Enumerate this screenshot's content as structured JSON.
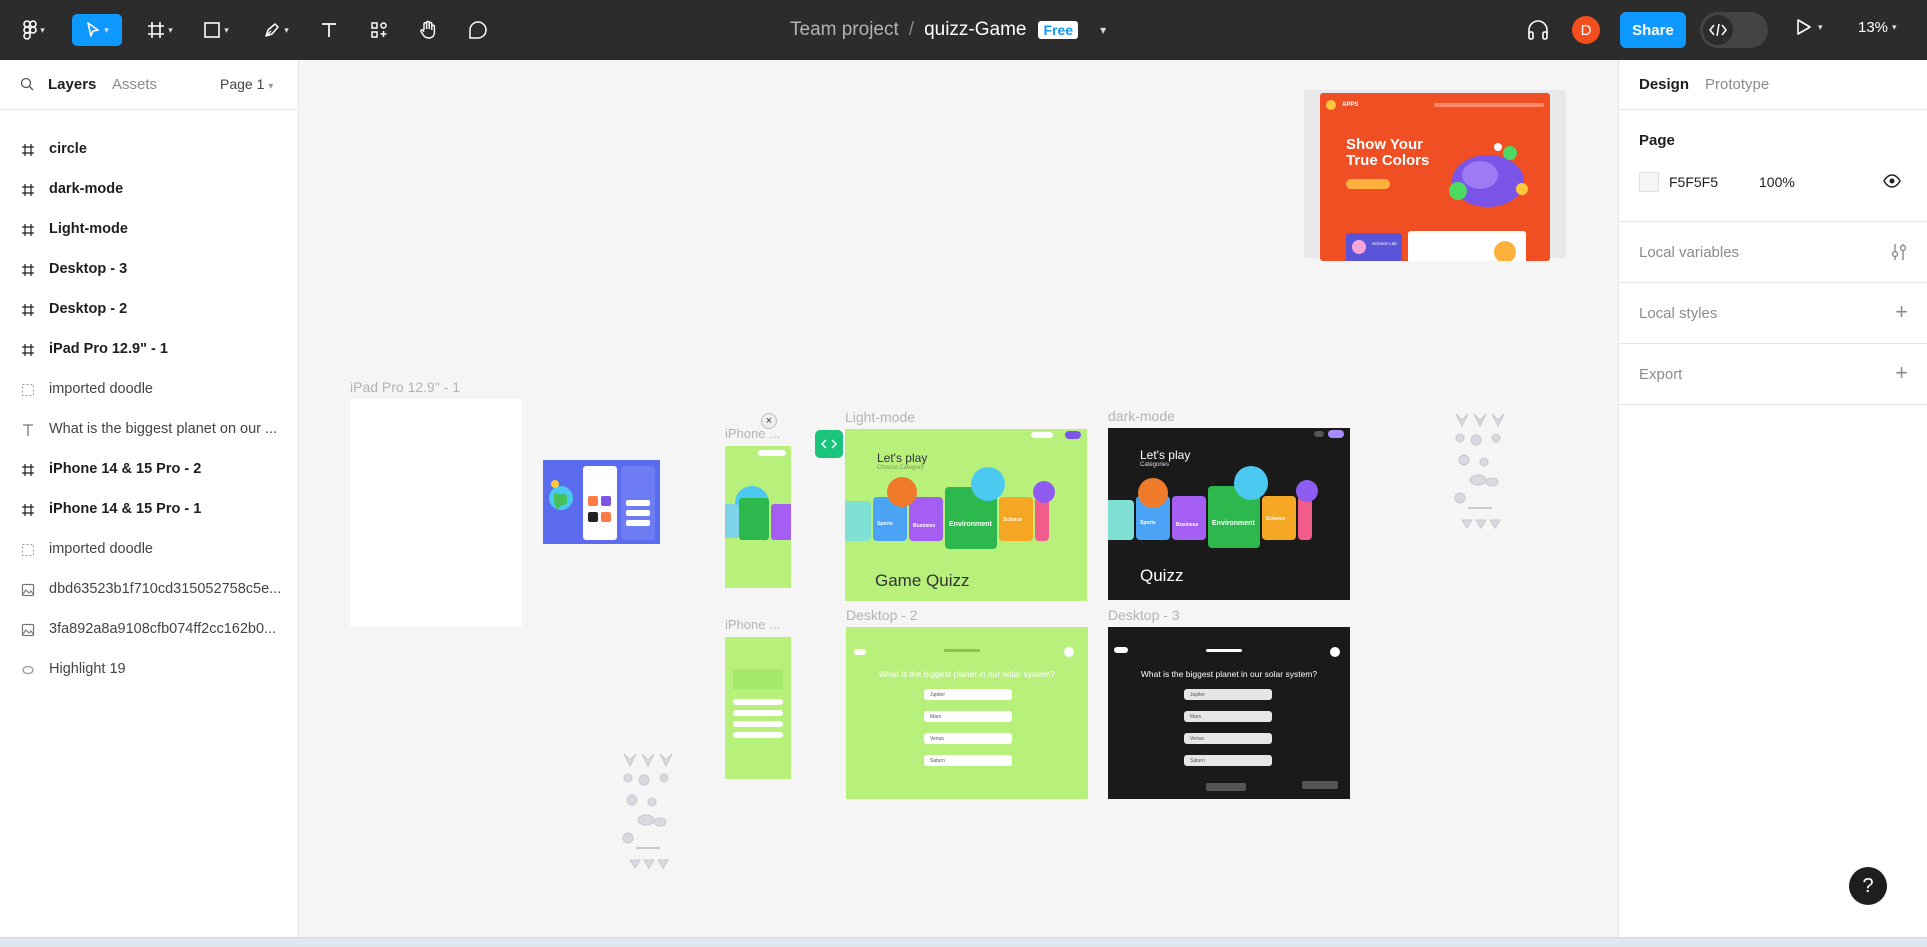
{
  "toolbar": {
    "breadcrumb_team": "Team project",
    "breadcrumb_sep": "/",
    "file_name": "quizz-Game",
    "plan_badge": "Free",
    "avatar_initial": "D",
    "share_label": "Share",
    "zoom_level": "13%"
  },
  "left_panel": {
    "tab_layers": "Layers",
    "tab_assets": "Assets",
    "page_selector": "Page 1",
    "layers": [
      {
        "name": "circle",
        "type": "frame"
      },
      {
        "name": "dark-mode",
        "type": "frame"
      },
      {
        "name": "Light-mode",
        "type": "frame"
      },
      {
        "name": "Desktop - 3",
        "type": "frame"
      },
      {
        "name": "Desktop - 2",
        "type": "frame"
      },
      {
        "name": "iPad Pro 12.9\" - 1",
        "type": "frame"
      },
      {
        "name": "imported doodle",
        "type": "group"
      },
      {
        "name": "What is the biggest planet on our ...",
        "type": "text"
      },
      {
        "name": "iPhone 14 & 15 Pro - 2",
        "type": "frame"
      },
      {
        "name": "iPhone 14 & 15 Pro - 1",
        "type": "frame"
      },
      {
        "name": "imported doodle",
        "type": "group"
      },
      {
        "name": "dbd63523b1f710cd315052758c5e...",
        "type": "image"
      },
      {
        "name": "3fa892a8a9108cfb074ff2cc162b0...",
        "type": "image"
      },
      {
        "name": "Highlight 19",
        "type": "highlight"
      }
    ]
  },
  "canvas": {
    "frames": {
      "ipad": "iPad Pro 12.9\" - 1",
      "iphone1": "iPhone ...",
      "iphone2": "iPhone ...",
      "light": "Light-mode",
      "dark": "dark-mode",
      "desktop2": "Desktop - 2",
      "desktop3": "Desktop - 3"
    },
    "light_mode": {
      "heading": "Let's play",
      "sub": "Choose Category",
      "title": "Game Quizz",
      "categories": [
        "Sports",
        "Business",
        "Environment",
        "Science"
      ]
    },
    "dark_mode": {
      "heading": "Let's play",
      "sub": "Categories",
      "title": "Quizz",
      "categories": [
        "Sports",
        "Business",
        "Environment",
        "Science"
      ]
    },
    "quiz": {
      "question": "What is the biggest planet in our solar system?",
      "answers": [
        "Jupiter",
        "Mars",
        "Venus",
        "Saturn"
      ]
    },
    "promo": {
      "brand": "APPS",
      "headline1": "Show Your",
      "headline2": "True Colors",
      "card": "Science Lab"
    },
    "colors": {
      "light_bg": "#b8f07c",
      "dark_bg": "#1a1a1a",
      "iphone_blue": "#5b6cf0",
      "promo_bg": "#f04e23",
      "accent": "#0d99ff"
    }
  },
  "right_panel": {
    "tab_design": "Design",
    "tab_prototype": "Prototype",
    "page_section": "Page",
    "page_color": "F5F5F5",
    "page_opacity": "100%",
    "local_variables": "Local variables",
    "local_styles": "Local styles",
    "export": "Export"
  },
  "help": "?"
}
